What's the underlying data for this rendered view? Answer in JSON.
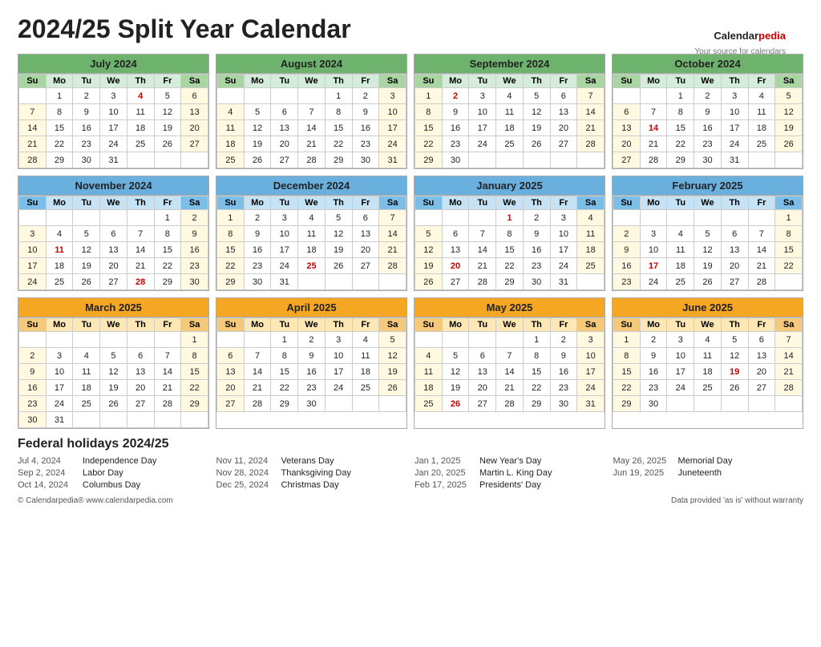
{
  "title": "2024/25 Split Year Calendar",
  "logo": {
    "part1": "Calendar",
    "part2": "pedia",
    "tagline": "Your source for calendars"
  },
  "months": [
    {
      "name": "July 2024",
      "headerColor": "green",
      "days": [
        [
          "Su",
          "Mo",
          "Tu",
          "We",
          "Th",
          "Fr",
          "Sa"
        ],
        [
          "",
          "1",
          "2",
          "3",
          "4*",
          "5",
          "6"
        ],
        [
          "7",
          "8",
          "9",
          "10",
          "11",
          "12",
          "13"
        ],
        [
          "14",
          "15",
          "16",
          "17",
          "18",
          "19",
          "20"
        ],
        [
          "21",
          "22",
          "23",
          "24",
          "25",
          "26",
          "27"
        ],
        [
          "28",
          "29",
          "30",
          "31",
          "",
          "",
          ""
        ]
      ],
      "holidays": {
        "4": "red"
      }
    },
    {
      "name": "August 2024",
      "headerColor": "green",
      "days": [
        [
          "Su",
          "Mo",
          "Tu",
          "We",
          "Th",
          "Fr",
          "Sa"
        ],
        [
          "",
          "",
          "",
          "",
          "1",
          "2",
          "3"
        ],
        [
          "4",
          "5",
          "6",
          "7",
          "8",
          "9",
          "10"
        ],
        [
          "11",
          "12",
          "13",
          "14",
          "15",
          "16",
          "17"
        ],
        [
          "18",
          "19",
          "20",
          "21",
          "22",
          "23",
          "24"
        ],
        [
          "25",
          "26",
          "27",
          "28",
          "29",
          "30",
          "31"
        ]
      ]
    },
    {
      "name": "September 2024",
      "headerColor": "green",
      "days": [
        [
          "Su",
          "Mo",
          "Tu",
          "We",
          "Th",
          "Fr",
          "Sa"
        ],
        [
          "1",
          "2*",
          "3",
          "4",
          "5",
          "6",
          "7"
        ],
        [
          "8",
          "9",
          "10",
          "11",
          "12",
          "13",
          "14"
        ],
        [
          "15",
          "16",
          "17",
          "18",
          "19",
          "20",
          "21"
        ],
        [
          "22",
          "23",
          "24",
          "25",
          "26",
          "27",
          "28"
        ],
        [
          "29",
          "30",
          "",
          "",
          "",
          "",
          ""
        ]
      ],
      "holidays": {
        "2": "red"
      }
    },
    {
      "name": "October 2024",
      "headerColor": "green",
      "days": [
        [
          "Su",
          "Mo",
          "Tu",
          "We",
          "Th",
          "Fr",
          "Sa"
        ],
        [
          "",
          "",
          "1",
          "2",
          "3",
          "4",
          "5"
        ],
        [
          "6",
          "7",
          "8",
          "9",
          "10",
          "11",
          "12"
        ],
        [
          "13",
          "14*",
          "15",
          "16",
          "17",
          "18",
          "19"
        ],
        [
          "20",
          "21",
          "22",
          "23",
          "24",
          "25",
          "26"
        ],
        [
          "27",
          "28",
          "29",
          "30",
          "31",
          "",
          ""
        ]
      ],
      "holidays": {
        "14": "red"
      }
    },
    {
      "name": "November 2024",
      "headerColor": "blue",
      "days": [
        [
          "Su",
          "Mo",
          "Tu",
          "We",
          "Th",
          "Fr",
          "Sa"
        ],
        [
          "",
          "",
          "",
          "",
          "",
          "1",
          "2"
        ],
        [
          "3",
          "4",
          "5",
          "6",
          "7",
          "8",
          "9"
        ],
        [
          "10",
          "11*",
          "12",
          "13",
          "14",
          "15",
          "16"
        ],
        [
          "17",
          "18",
          "19",
          "20",
          "21",
          "22",
          "23"
        ],
        [
          "24",
          "25",
          "26",
          "27",
          "28*",
          "29",
          "30"
        ]
      ],
      "holidays": {
        "11": "red",
        "28": "red"
      }
    },
    {
      "name": "December 2024",
      "headerColor": "blue",
      "days": [
        [
          "Su",
          "Mo",
          "Tu",
          "We",
          "Th",
          "Fr",
          "Sa"
        ],
        [
          "1",
          "2",
          "3",
          "4",
          "5",
          "6",
          "7"
        ],
        [
          "8",
          "9",
          "10",
          "11",
          "12",
          "13",
          "14"
        ],
        [
          "15",
          "16",
          "17",
          "18",
          "19",
          "20",
          "21"
        ],
        [
          "22",
          "23",
          "24",
          "25*",
          "26",
          "27",
          "28"
        ],
        [
          "29",
          "30",
          "31",
          "",
          "",
          "",
          ""
        ]
      ],
      "holidays": {
        "25": "red"
      }
    },
    {
      "name": "January 2025",
      "headerColor": "blue",
      "days": [
        [
          "Su",
          "Mo",
          "Tu",
          "We",
          "Th",
          "Fr",
          "Sa"
        ],
        [
          "",
          "",
          "",
          "1*",
          "2",
          "3",
          "4"
        ],
        [
          "5",
          "6",
          "7",
          "8",
          "9",
          "10",
          "11"
        ],
        [
          "12",
          "13",
          "14",
          "15",
          "16",
          "17",
          "18"
        ],
        [
          "19",
          "20*",
          "21",
          "22",
          "23",
          "24",
          "25"
        ],
        [
          "26",
          "27",
          "28",
          "29",
          "30",
          "31",
          ""
        ]
      ],
      "holidays": {
        "1": "red",
        "20": "red"
      }
    },
    {
      "name": "February 2025",
      "headerColor": "blue",
      "days": [
        [
          "Su",
          "Mo",
          "Tu",
          "We",
          "Th",
          "Fr",
          "Sa"
        ],
        [
          "",
          "",
          "",
          "",
          "",
          "",
          "1"
        ],
        [
          "2",
          "3",
          "4",
          "5",
          "6",
          "7",
          "8"
        ],
        [
          "9",
          "10",
          "11",
          "12",
          "13",
          "14",
          "15"
        ],
        [
          "16",
          "17*",
          "18",
          "19",
          "20",
          "21",
          "22"
        ],
        [
          "23",
          "24",
          "25",
          "26",
          "27",
          "28",
          ""
        ]
      ],
      "holidays": {
        "17": "red"
      }
    },
    {
      "name": "March 2025",
      "headerColor": "orange",
      "days": [
        [
          "Su",
          "Mo",
          "Tu",
          "We",
          "Th",
          "Fr",
          "Sa"
        ],
        [
          "",
          "",
          "",
          "",
          "",
          "",
          "1"
        ],
        [
          "2",
          "3",
          "4",
          "5",
          "6",
          "7",
          "8"
        ],
        [
          "9",
          "10",
          "11",
          "12",
          "13",
          "14",
          "15"
        ],
        [
          "16",
          "17",
          "18",
          "19",
          "20",
          "21",
          "22"
        ],
        [
          "23",
          "24",
          "25",
          "26",
          "27",
          "28",
          "29"
        ],
        [
          "30",
          "31",
          "",
          "",
          "",
          "",
          ""
        ]
      ]
    },
    {
      "name": "April 2025",
      "headerColor": "orange",
      "days": [
        [
          "Su",
          "Mo",
          "Tu",
          "We",
          "Th",
          "Fr",
          "Sa"
        ],
        [
          "",
          "",
          "1",
          "2",
          "3",
          "4",
          "5"
        ],
        [
          "6",
          "7",
          "8",
          "9",
          "10",
          "11",
          "12"
        ],
        [
          "13",
          "14",
          "15",
          "16",
          "17",
          "18",
          "19"
        ],
        [
          "20",
          "21",
          "22",
          "23",
          "24",
          "25",
          "26"
        ],
        [
          "27",
          "28",
          "29",
          "30",
          "",
          "",
          ""
        ]
      ]
    },
    {
      "name": "May 2025",
      "headerColor": "orange",
      "days": [
        [
          "Su",
          "Mo",
          "Tu",
          "We",
          "Th",
          "Fr",
          "Sa"
        ],
        [
          "",
          "",
          "",
          "",
          "1",
          "2",
          "3"
        ],
        [
          "4",
          "5",
          "6",
          "7",
          "8",
          "9",
          "10"
        ],
        [
          "11",
          "12",
          "13",
          "14",
          "15",
          "16",
          "17"
        ],
        [
          "18",
          "19",
          "20",
          "21",
          "22",
          "23",
          "24"
        ],
        [
          "25",
          "26*",
          "27",
          "28",
          "29",
          "30",
          "31"
        ]
      ],
      "holidays": {
        "26": "red"
      }
    },
    {
      "name": "June 2025",
      "headerColor": "orange",
      "days": [
        [
          "Su",
          "Mo",
          "Tu",
          "We",
          "Th",
          "Fr",
          "Sa"
        ],
        [
          "1",
          "2",
          "3",
          "4",
          "5",
          "6",
          "7"
        ],
        [
          "8",
          "9",
          "10",
          "11",
          "12",
          "13",
          "14"
        ],
        [
          "15",
          "16",
          "17",
          "18",
          "19*",
          "20",
          "21"
        ],
        [
          "22",
          "23",
          "24",
          "25",
          "26",
          "27",
          "28"
        ],
        [
          "29",
          "30",
          "",
          "",
          "",
          "",
          ""
        ]
      ],
      "holidays": {
        "19": "red"
      }
    }
  ],
  "holidays": {
    "title": "Federal holidays 2024/25",
    "items": [
      {
        "date": "Jul 4, 2024",
        "name": "Independence Day"
      },
      {
        "date": "Sep 2, 2024",
        "name": "Labor Day"
      },
      {
        "date": "Oct 14, 2024",
        "name": "Columbus Day"
      },
      {
        "date": "Nov 11, 2024",
        "name": "Veterans Day"
      },
      {
        "date": "Nov 28, 2024",
        "name": "Thanksgiving Day"
      },
      {
        "date": "Dec 25, 2024",
        "name": "Christmas Day"
      },
      {
        "date": "Jan 1, 2025",
        "name": "New Year's Day"
      },
      {
        "date": "Jan 20, 2025",
        "name": "Martin L. King Day"
      },
      {
        "date": "Feb 17, 2025",
        "name": "Presidents' Day"
      },
      {
        "date": "May 26, 2025",
        "name": "Memorial Day"
      },
      {
        "date": "Jun 19, 2025",
        "name": "Juneteenth"
      }
    ]
  },
  "footer": {
    "left": "© Calendarpedia®   www.calendarpedia.com",
    "right": "Data provided 'as is' without warranty"
  }
}
